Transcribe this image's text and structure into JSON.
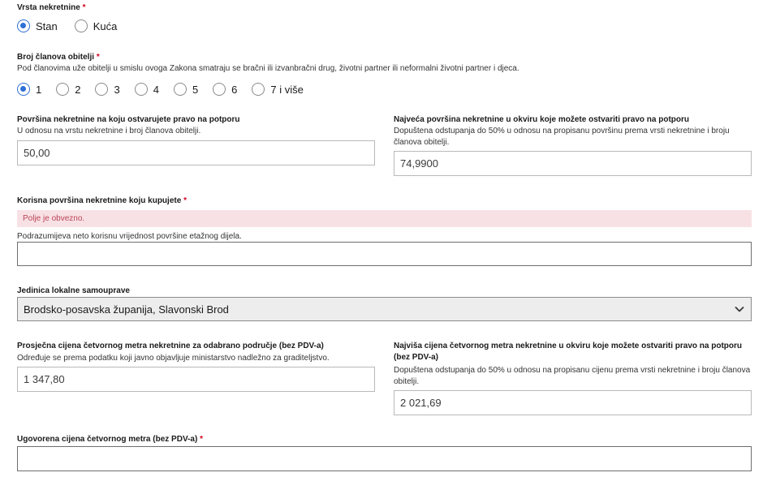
{
  "property_type": {
    "label": "Vrsta nekretnine",
    "required_mark": "*",
    "options": [
      "Stan",
      "Kuća"
    ],
    "selected": "Stan"
  },
  "family_members": {
    "label": "Broj članova obitelji",
    "required_mark": "*",
    "help": "Pod članovima uže obitelji u smislu ovoga Zakona smatraju se bračni ili izvanbračni drug, životni partner ili neformalni životni partner i djeca.",
    "options": [
      "1",
      "2",
      "3",
      "4",
      "5",
      "6",
      "7 i više"
    ],
    "selected": "1"
  },
  "eligible_area": {
    "label": "Površina nekretnine na koju ostvarujete pravo na potporu",
    "help": "U odnosu na vrstu nekretnine i broj članova obitelji.",
    "value": "50,00"
  },
  "max_area": {
    "label": "Najveća površina nekretnine u okviru koje možete ostvariti pravo na potporu",
    "help": "Dopuštena odstupanja do 50% u odnosu na propisanu površinu prema vrsti nekretnine i broju članova obitelji.",
    "value": "74,9900"
  },
  "usable_area": {
    "label": "Korisna površina nekretnine koju kupujete",
    "required_mark": "*",
    "error": "Polje je obvezno.",
    "help": "Podrazumijeva neto korisnu vrijednost površine etažnog dijela.",
    "value": ""
  },
  "local_unit": {
    "label": "Jedinica lokalne samouprave",
    "selected": "Brodsko-posavska županija, Slavonski Brod"
  },
  "avg_price": {
    "label": "Prosječna cijena četvornog metra nekretnine za odabrano područje (bez PDV-a)",
    "help": "Određuje se prema podatku koji javno objavljuje ministarstvo nadležno za graditeljstvo.",
    "value": "1 347,80"
  },
  "max_price": {
    "label": "Najviša cijena četvornog metra nekretnine u okviru koje možete ostvariti pravo na potporu (bez PDV-a)",
    "help": "Dopuštena odstupanja do 50% u odnosu na propisanu cijenu prema vrsti nekretnine i broju članova obitelji.",
    "value": "2 021,69"
  },
  "agreed_price": {
    "label": "Ugovorena cijena četvornog metra (bez PDV-a)",
    "required_mark": "*",
    "value": ""
  },
  "colors": {
    "accent": "#2f6fd6",
    "required": "#d0021b",
    "error_bg": "#f8e1e4",
    "error_text": "#b94456"
  },
  "icons": {
    "select_chevron": "chevron-down-icon"
  }
}
